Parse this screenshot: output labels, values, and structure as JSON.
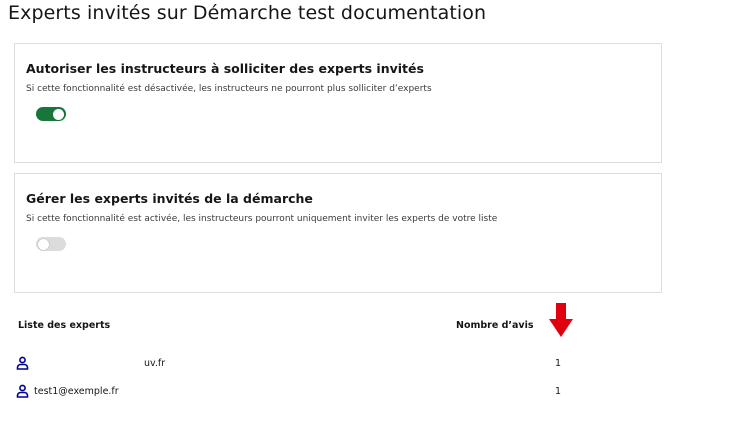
{
  "page": {
    "title": "Experts invités sur Démarche test documentation"
  },
  "settings": [
    {
      "title": "Autoriser les instructeurs à solliciter des experts invités",
      "description": "Si cette fonctionnalité est désactivée, les instructeurs ne pourront plus solliciter d’experts",
      "enabled": true
    },
    {
      "title": "Gérer les experts invités de la démarche",
      "description": "Si cette fonctionnalité est activée, les instructeurs pourront uniquement inviter les experts de votre liste",
      "enabled": false
    }
  ],
  "experts_list": {
    "header_name": "Liste des experts",
    "header_count": "Nombre d’avis",
    "rows": [
      {
        "email": "uv.fr",
        "count": "1"
      },
      {
        "email": "test1@exemple.fr",
        "count": "1"
      }
    ]
  },
  "colors": {
    "toggle_on": "#18753c",
    "icon_accent": "#000091",
    "annotation_arrow": "#e1000f"
  },
  "icons": {
    "user": "user-icon",
    "annotation": "arrow-down-icon"
  }
}
